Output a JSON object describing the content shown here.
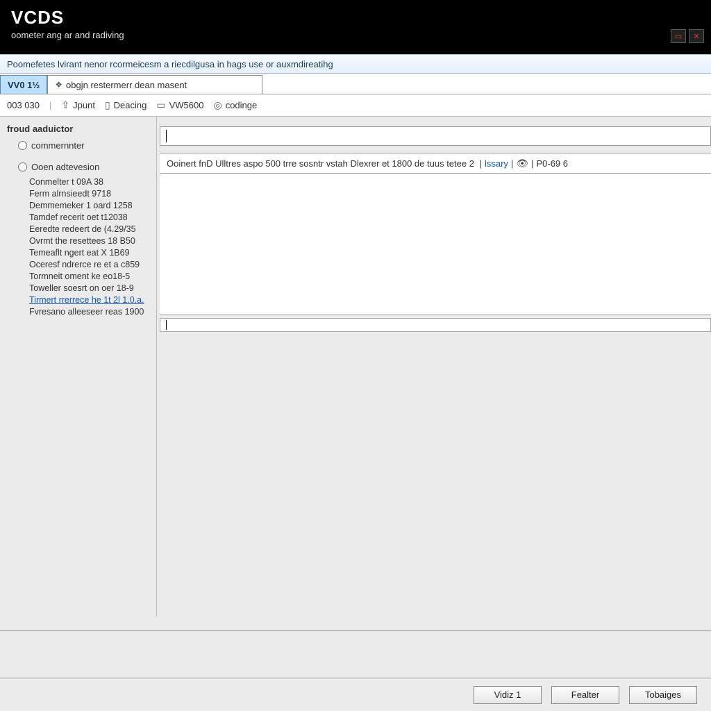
{
  "header": {
    "title": "VCDS",
    "subtitle": "oometer ang ar and radiving"
  },
  "subheader": "Poomefetes lvirant nenor rcormeicesm a riecdilgusa in hags use or auxmdireatihg",
  "tabs": [
    {
      "label": "VV0 1½",
      "active": true
    },
    {
      "label": "obgjn restermerr dean masent",
      "active": false,
      "icon": "wing-icon"
    }
  ],
  "toolbar": {
    "t1": "003 030",
    "sep1": "|",
    "t2": "Jpunt",
    "t3": "Deacing",
    "t4": "VW5600",
    "t5": "codinge"
  },
  "sidebar": {
    "title": "froud aaduictor",
    "radios": [
      {
        "label": "commernnter",
        "checked": false
      },
      {
        "label": "Ooen adtevesion",
        "checked": false
      }
    ],
    "tree": [
      "Conmelter t 09A 38",
      "Ferm alrnsieedt 9718",
      "Demmemeker 1 oard 1258",
      "Tamdef recerit oet t12038",
      "Eeredte redeert de (4.29/35",
      "Ovrmt the resettees 18 B50",
      "Temeaflt ngert eat X 1B69",
      "Oceresf ndrerce re et a c859",
      "Tormneit oment ke eo18-5",
      "Toweller soesrt on oer 18-9",
      "Tirmert rrerrece he 1t 2l 1.0.a.",
      "Fvresano alleeseer reas 1900"
    ],
    "selected_index": 10
  },
  "infobar": {
    "prefix": "Ooinert fnD Ulltres aspo 500 trre sosntr vstah Dlexrer et 1800 de tuus tetee 2",
    "link": "lssary",
    "sep": "|",
    "code": "P0-69 6"
  },
  "footer": {
    "btn1": "Vidiz 1",
    "btn2": "Fealter",
    "btn3": "Tobaiges"
  }
}
